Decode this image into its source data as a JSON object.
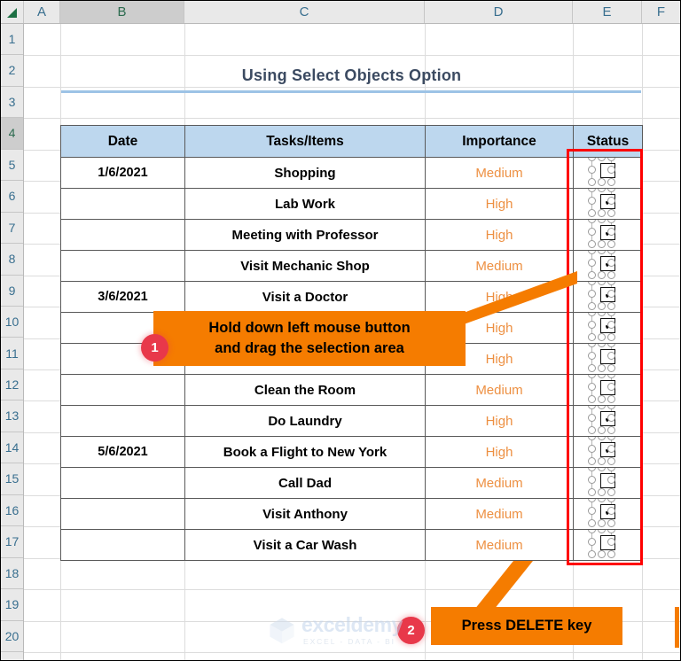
{
  "app": {
    "type": "spreadsheet"
  },
  "grid": {
    "columns": [
      {
        "label": "A",
        "selected": false
      },
      {
        "label": "B",
        "selected": true
      },
      {
        "label": "C",
        "selected": false
      },
      {
        "label": "D",
        "selected": false
      },
      {
        "label": "E",
        "selected": false
      },
      {
        "label": "F",
        "selected": false
      }
    ],
    "rows": [
      {
        "label": "1",
        "selected": false
      },
      {
        "label": "2",
        "selected": false
      },
      {
        "label": "3",
        "selected": false
      },
      {
        "label": "4",
        "selected": true
      },
      {
        "label": "5",
        "selected": false
      },
      {
        "label": "6",
        "selected": false
      },
      {
        "label": "7",
        "selected": false
      },
      {
        "label": "8",
        "selected": false
      },
      {
        "label": "9",
        "selected": false
      },
      {
        "label": "10",
        "selected": false
      },
      {
        "label": "11",
        "selected": false
      },
      {
        "label": "12",
        "selected": false
      },
      {
        "label": "13",
        "selected": false
      },
      {
        "label": "14",
        "selected": false
      },
      {
        "label": "15",
        "selected": false
      },
      {
        "label": "16",
        "selected": false
      },
      {
        "label": "17",
        "selected": false
      },
      {
        "label": "18",
        "selected": false
      },
      {
        "label": "19",
        "selected": false
      },
      {
        "label": "20",
        "selected": false
      }
    ],
    "select_all_icon": "select-all-triangle-icon"
  },
  "sheet": {
    "title": "Using Select Objects Option",
    "title_color": "#3b4a61",
    "rule_color": "#9dc3e6"
  },
  "table": {
    "header_bg": "#bdd7ee",
    "headers": [
      "Date",
      "Tasks/Items",
      "Importance",
      "Status"
    ],
    "importance_color": "#ed9042",
    "rows": [
      {
        "date": "1/6/2021",
        "task": "Shopping",
        "importance": "Medium",
        "checked": false
      },
      {
        "date": "",
        "task": "Lab Work",
        "importance": "High",
        "checked": true
      },
      {
        "date": "",
        "task": "Meeting with Professor",
        "importance": "High",
        "checked": true
      },
      {
        "date": "",
        "task": "Visit Mechanic Shop",
        "importance": "Medium",
        "checked": true
      },
      {
        "date": "3/6/2021",
        "task": "Visit a Doctor",
        "importance": "High",
        "checked": true
      },
      {
        "date": "",
        "task": "",
        "importance": "High",
        "checked": true
      },
      {
        "date": "",
        "task": "",
        "importance": "High",
        "checked": false
      },
      {
        "date": "",
        "task": "Clean the Room",
        "importance": "Medium",
        "checked": false
      },
      {
        "date": "",
        "task": "Do Laundry",
        "importance": "High",
        "checked": true
      },
      {
        "date": "5/6/2021",
        "task": "Book a Flight to New York",
        "importance": "High",
        "checked": true
      },
      {
        "date": "",
        "task": "Call Dad",
        "importance": "Medium",
        "checked": false
      },
      {
        "date": "",
        "task": "Visit Anthony",
        "importance": "Medium",
        "checked": true
      },
      {
        "date": "",
        "task": "Visit a Car Wash",
        "importance": "Medium",
        "checked": false
      }
    ],
    "checkbox_checked_glyph": "✔"
  },
  "selection": {
    "rect_color": "#ff0000",
    "handles_color": "#9a9a9a"
  },
  "callouts": {
    "accent_color": "#f57c00",
    "badge_color": "#e8384a",
    "step1": {
      "badge": "1",
      "line1": "Hold down left mouse button",
      "line2": "and drag the selection area"
    },
    "step2": {
      "badge": "2",
      "text": "Press DELETE key"
    }
  },
  "watermark": {
    "name": "exceldemy",
    "tagline": "EXCEL - DATA - BI"
  }
}
